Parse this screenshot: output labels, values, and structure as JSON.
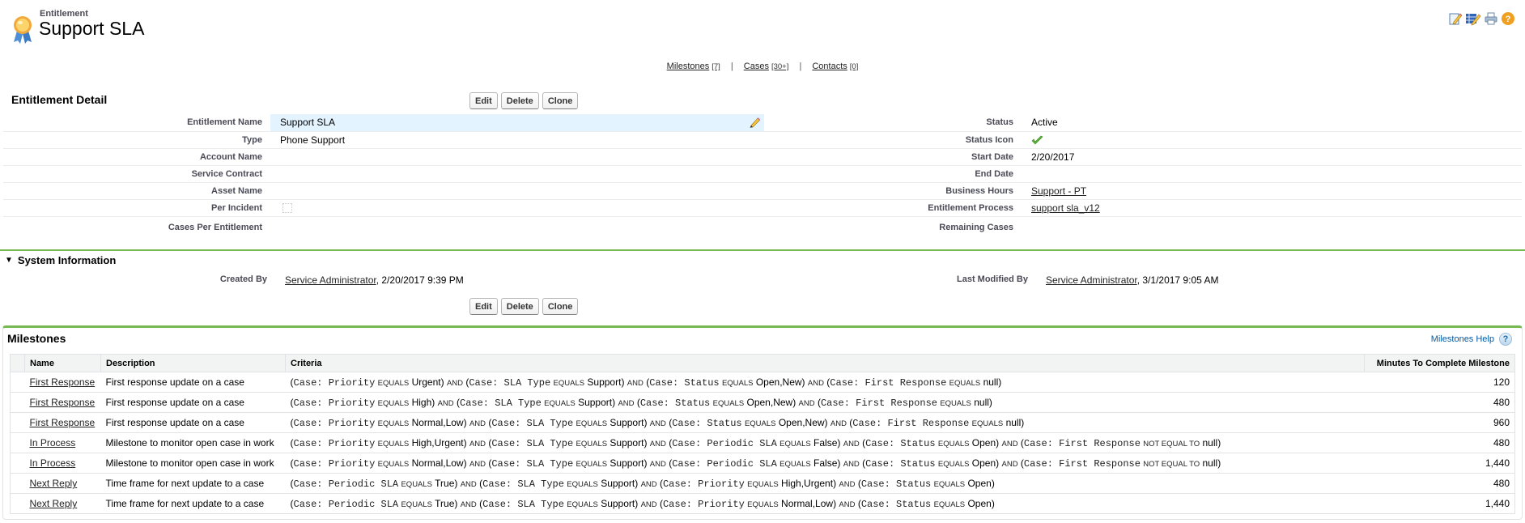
{
  "header": {
    "object_type": "Entitlement",
    "title": "Support SLA",
    "tools": [
      {
        "icon": "edit-layout-icon",
        "label": "Edit Layout"
      },
      {
        "icon": "edit-list-icon",
        "label": "Edit List"
      },
      {
        "icon": "printer-icon",
        "label": "Printable View"
      },
      {
        "icon": "help-icon",
        "label": "Help"
      }
    ]
  },
  "related_links": [
    {
      "label": "Milestones",
      "count": "[7]"
    },
    {
      "label": "Cases",
      "count": "[30+]"
    },
    {
      "label": "Contacts",
      "count": "[0]"
    }
  ],
  "related_separator": "|",
  "detail": {
    "title": "Entitlement Detail",
    "buttons": {
      "edit": "Edit",
      "delete": "Delete",
      "clone": "Clone"
    },
    "left_fields": [
      {
        "label": "Entitlement Name",
        "value": "Support SLA"
      },
      {
        "label": "Type",
        "value": "Phone Support"
      },
      {
        "label": "Account Name",
        "value": ""
      },
      {
        "label": "Service Contract",
        "value": ""
      },
      {
        "label": "Asset Name",
        "value": ""
      },
      {
        "label": "Per Incident",
        "value": "",
        "checked": false
      },
      {
        "label": "Cases Per Entitlement",
        "value": ""
      }
    ],
    "right_fields": [
      {
        "label": "Status",
        "value": "Active"
      },
      {
        "label": "Status Icon",
        "value": "",
        "icon": "green-check-icon"
      },
      {
        "label": "Start Date",
        "value": "2/20/2017"
      },
      {
        "label": "End Date",
        "value": ""
      },
      {
        "label": "Business Hours",
        "value": "Support - PT",
        "link": true
      },
      {
        "label": "Entitlement Process",
        "value": "support sla_v12",
        "link": true
      },
      {
        "label": "Remaining Cases",
        "value": ""
      }
    ]
  },
  "system_info": {
    "title": "System Information",
    "created_by_label": "Created By",
    "created_by_user": "Service Administrator",
    "created_by_date": ", 2/20/2017 9:39 PM",
    "modified_by_label": "Last Modified By",
    "modified_by_user": "Service Administrator",
    "modified_by_date": ", 3/1/2017 9:05 AM"
  },
  "milestones": {
    "title": "Milestones",
    "help_label": "Milestones Help",
    "columns": [
      "Name",
      "Description",
      "Criteria",
      "Minutes To Complete Milestone"
    ],
    "rows": [
      {
        "name": "First Response",
        "description": "First response update on a case",
        "criteria": [
          {
            "field": "Case: Priority",
            "op": "EQUALS",
            "value": "Urgent"
          },
          {
            "field": "Case: SLA Type",
            "op": "EQUALS",
            "value": "Support"
          },
          {
            "field": "Case: Status",
            "op": "EQUALS",
            "value": "Open,New"
          },
          {
            "field": "Case: First Response",
            "op": "EQUALS",
            "value": "null"
          }
        ],
        "minutes": "120"
      },
      {
        "name": "First Response",
        "description": "First response update on a case",
        "criteria": [
          {
            "field": "Case: Priority",
            "op": "EQUALS",
            "value": "High"
          },
          {
            "field": "Case: SLA Type",
            "op": "EQUALS",
            "value": "Support"
          },
          {
            "field": "Case: Status",
            "op": "EQUALS",
            "value": "Open,New"
          },
          {
            "field": "Case: First Response",
            "op": "EQUALS",
            "value": "null"
          }
        ],
        "minutes": "480"
      },
      {
        "name": "First Response",
        "description": "First response update on a case",
        "criteria": [
          {
            "field": "Case: Priority",
            "op": "EQUALS",
            "value": "Normal,Low"
          },
          {
            "field": "Case: SLA Type",
            "op": "EQUALS",
            "value": "Support"
          },
          {
            "field": "Case: Status",
            "op": "EQUALS",
            "value": "Open,New"
          },
          {
            "field": "Case: First Response",
            "op": "EQUALS",
            "value": "null"
          }
        ],
        "minutes": "960"
      },
      {
        "name": "In Process",
        "description": "Milestone to monitor open case in work",
        "criteria": [
          {
            "field": "Case: Priority",
            "op": "EQUALS",
            "value": "High,Urgent"
          },
          {
            "field": "Case: SLA Type",
            "op": "EQUALS",
            "value": "Support"
          },
          {
            "field": "Case: Periodic SLA",
            "op": "EQUALS",
            "value": "False"
          },
          {
            "field": "Case: Status",
            "op": "EQUALS",
            "value": "Open"
          },
          {
            "field": "Case: First Response",
            "op": "NOT EQUAL TO",
            "value": "null"
          }
        ],
        "minutes": "480"
      },
      {
        "name": "In Process",
        "description": "Milestone to monitor open case in work",
        "criteria": [
          {
            "field": "Case: Priority",
            "op": "EQUALS",
            "value": "Normal,Low"
          },
          {
            "field": "Case: SLA Type",
            "op": "EQUALS",
            "value": "Support"
          },
          {
            "field": "Case: Periodic SLA",
            "op": "EQUALS",
            "value": "False"
          },
          {
            "field": "Case: Status",
            "op": "EQUALS",
            "value": "Open"
          },
          {
            "field": "Case: First Response",
            "op": "NOT EQUAL TO",
            "value": "null"
          }
        ],
        "minutes": "1,440"
      },
      {
        "name": "Next Reply",
        "description": "Time frame for next update to a case",
        "criteria": [
          {
            "field": "Case: Periodic SLA",
            "op": "EQUALS",
            "value": "True"
          },
          {
            "field": "Case: SLA Type",
            "op": "EQUALS",
            "value": "Support"
          },
          {
            "field": "Case: Priority",
            "op": "EQUALS",
            "value": "High,Urgent"
          },
          {
            "field": "Case: Status",
            "op": "EQUALS",
            "value": "Open"
          }
        ],
        "minutes": "480"
      },
      {
        "name": "Next Reply",
        "description": "Time frame for next update to a case",
        "criteria": [
          {
            "field": "Case: Periodic SLA",
            "op": "EQUALS",
            "value": "True"
          },
          {
            "field": "Case: SLA Type",
            "op": "EQUALS",
            "value": "Support"
          },
          {
            "field": "Case: Priority",
            "op": "EQUALS",
            "value": "Normal,Low"
          },
          {
            "field": "Case: Status",
            "op": "EQUALS",
            "value": "Open"
          }
        ],
        "minutes": "1,440"
      }
    ],
    "criteria_joiner": "AND"
  },
  "colors": {
    "section_accent": "#76b852",
    "highlight_field_bg": "#e3f3ff",
    "label_color": "#4a4a56",
    "help_link": "#015ba7"
  }
}
